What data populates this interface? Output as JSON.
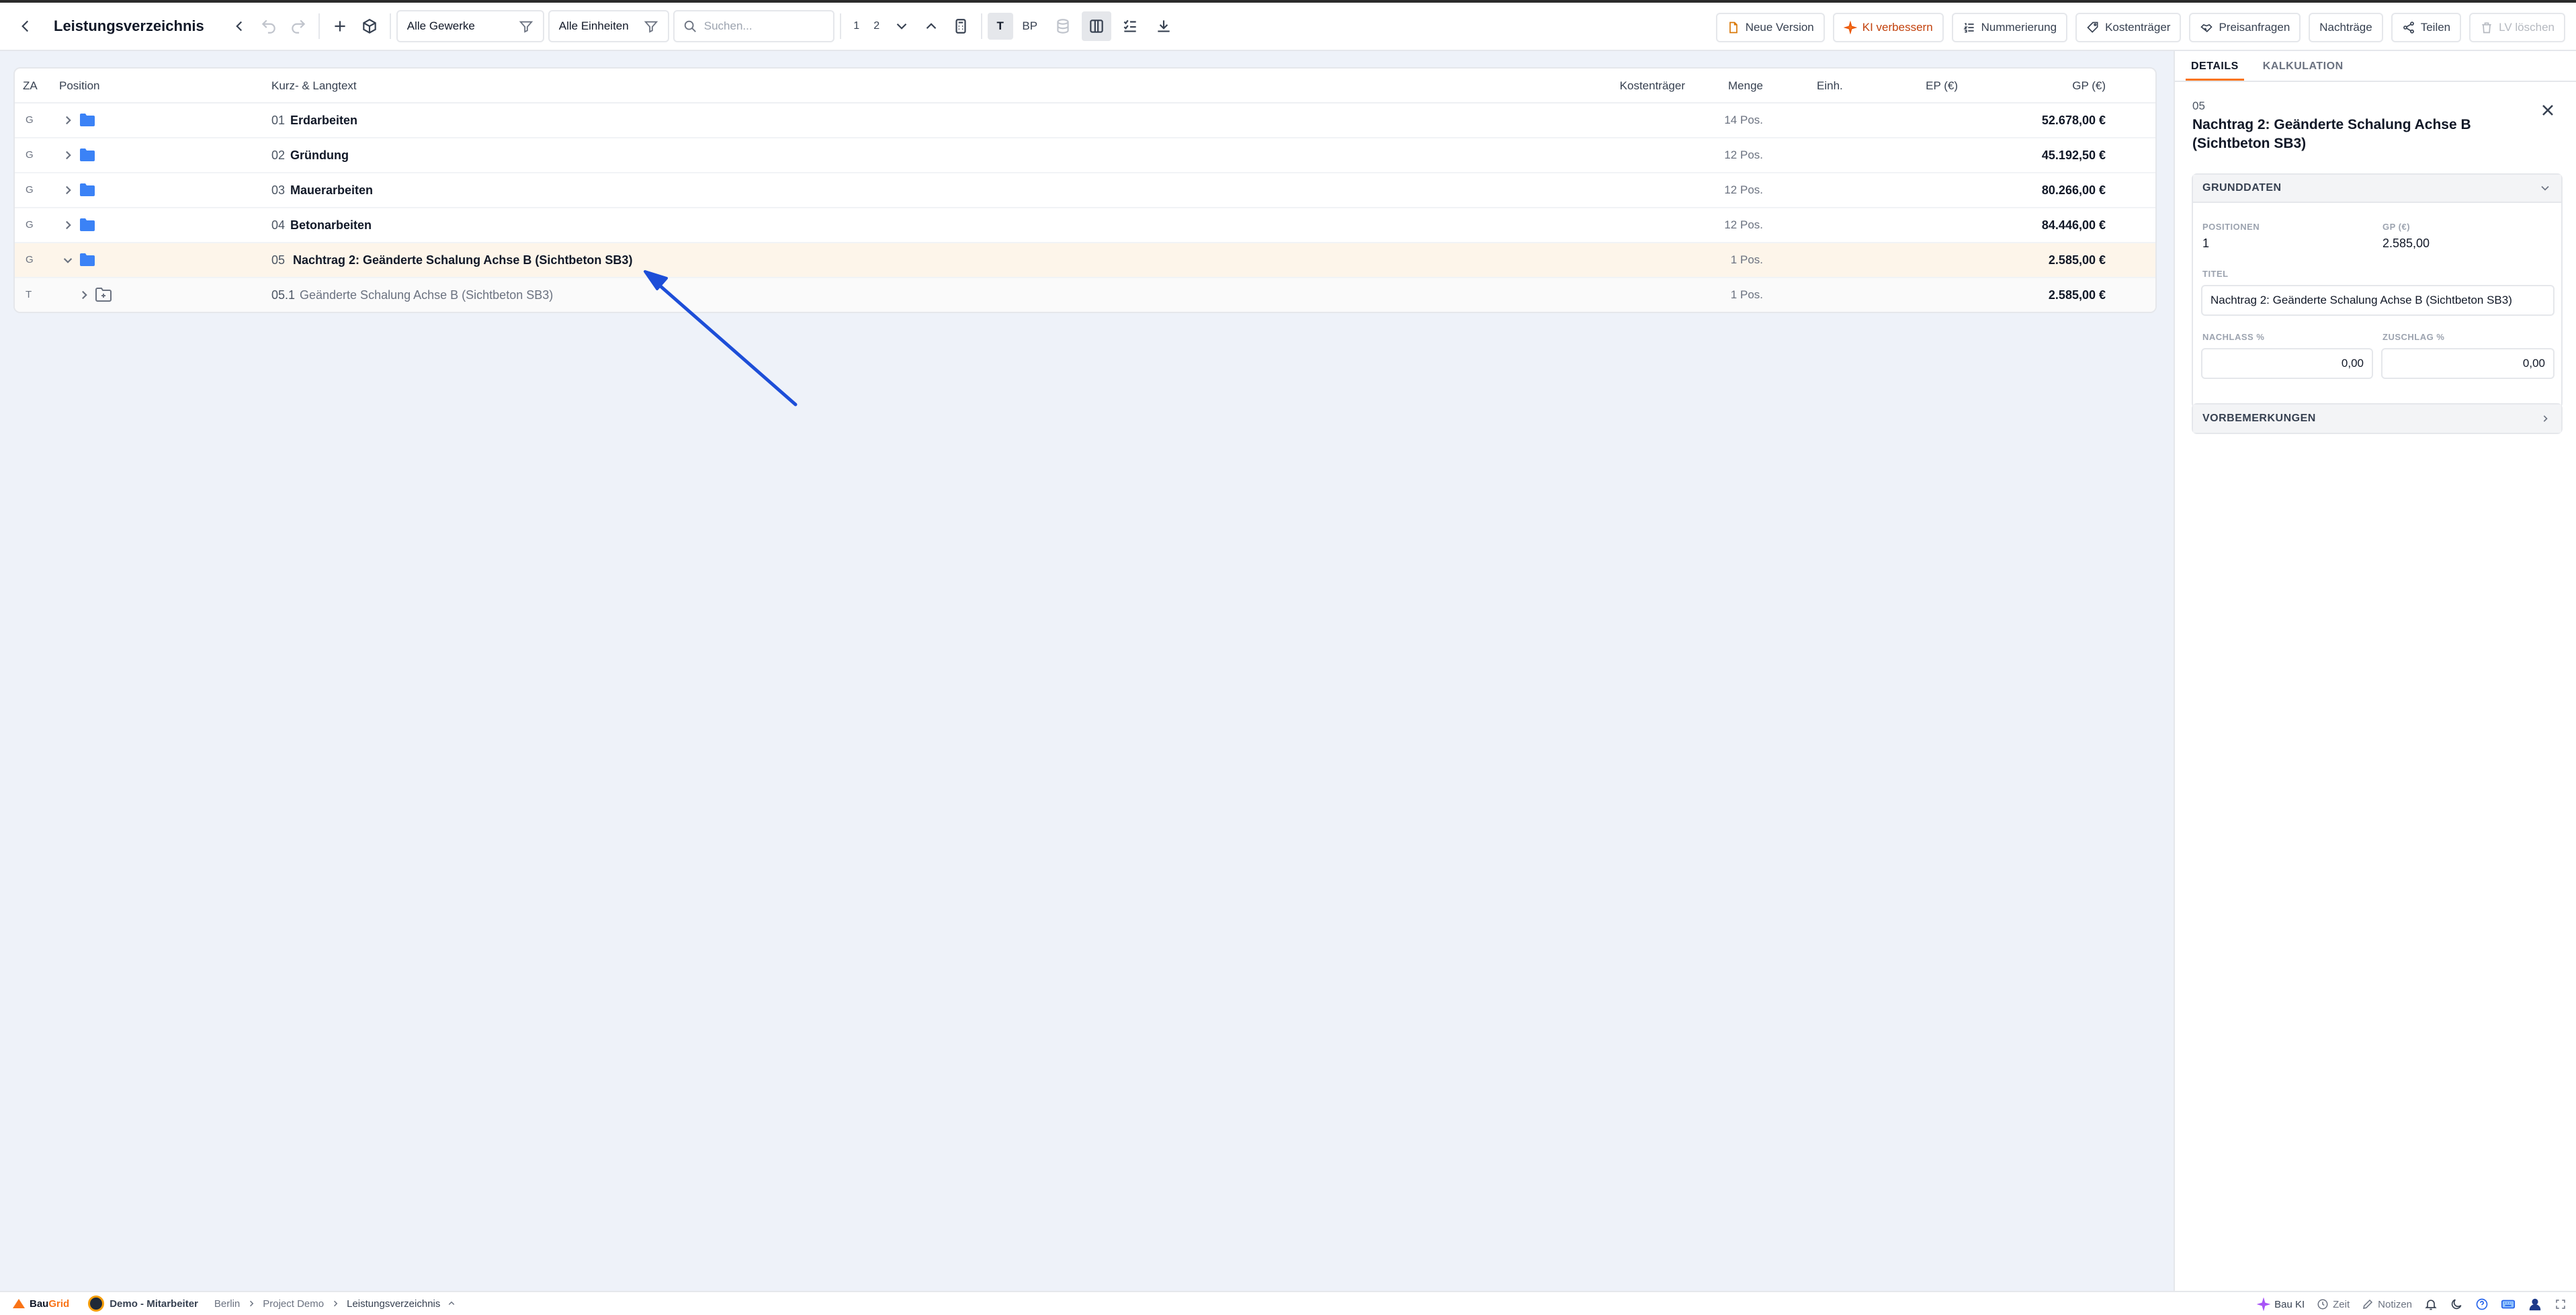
{
  "header": {
    "title": "Leistungsverzeichnis",
    "filter_gewerke": "Alle Gewerke",
    "filter_einheiten": "Alle Einheiten",
    "search_placeholder": "Suchen...",
    "level_1": "1",
    "level_2": "2",
    "view_t": "T",
    "view_bp": "BP",
    "actions": {
      "neue_version": "Neue Version",
      "ki_verbessern": "KI verbessern",
      "nummerierung": "Nummerierung",
      "kostentraeger": "Kostenträger",
      "preisanfragen": "Preisanfragen",
      "nachtraege": "Nachträge",
      "teilen": "Teilen",
      "lv_loeschen": "LV löschen"
    }
  },
  "table": {
    "columns": {
      "za": "ZA",
      "position": "Position",
      "text": "Kurz- & Langtext",
      "kostentraeger": "Kostenträger",
      "menge": "Menge",
      "einh": "Einh.",
      "ep": "EP (€)",
      "gp": "GP (€)"
    },
    "rows": [
      {
        "za": "G",
        "num": "01",
        "name": "Erdarbeiten",
        "qty": "14 Pos.",
        "gp": "52.678,00 €"
      },
      {
        "za": "G",
        "num": "02",
        "name": "Gründung",
        "qty": "12 Pos.",
        "gp": "45.192,50 €"
      },
      {
        "za": "G",
        "num": "03",
        "name": "Mauerarbeiten",
        "qty": "12 Pos.",
        "gp": "80.266,00 €"
      },
      {
        "za": "G",
        "num": "04",
        "name": "Betonarbeiten",
        "qty": "12 Pos.",
        "gp": "84.446,00 €"
      },
      {
        "za": "G",
        "num": "05",
        "name": "Nachtrag 2: Geänderte Schalung Achse B (Sichtbeton SB3)",
        "qty": "1 Pos.",
        "gp": "2.585,00 €"
      },
      {
        "za": "T",
        "num": "05.1",
        "name": "Geänderte Schalung Achse B (Sichtbeton SB3)",
        "qty": "1 Pos.",
        "gp": "2.585,00 €"
      }
    ]
  },
  "details": {
    "tab_details": "DETAILS",
    "tab_kalkulation": "KALKULATION",
    "number": "05",
    "title": "Nachtrag 2: Geänderte Schalung Achse B (Sichtbeton SB3)",
    "grunddaten": {
      "heading": "GRUNDDATEN",
      "positionen_label": "POSITIONEN",
      "positionen_value": "1",
      "gp_label": "GP (€)",
      "gp_value": "2.585,00",
      "titel_label": "TITEL",
      "titel_value": "Nachtrag 2: Geänderte Schalung Achse B (Sichtbeton SB3)",
      "nachlass_label": "NACHLASS %",
      "nachlass_value": "0,00",
      "zuschlag_label": "ZUSCHLAG %",
      "zuschlag_value": "0,00"
    },
    "vorbemerkungen": "VORBEMERKUNGEN"
  },
  "footer": {
    "brand_bau": "Bau",
    "brand_grid": "Grid",
    "user": "Demo - Mitarbeiter",
    "crumbs": [
      "Berlin",
      "Project Demo",
      "Leistungsverzeichnis"
    ],
    "bau_ki": "Bau KI",
    "zeit": "Zeit",
    "notizen": "Notizen"
  },
  "colors": {
    "accent": "#f97316",
    "folder": "#3b82f6",
    "selected_row": "#fdf5ea",
    "annotation_arrow": "#1d4ed8"
  }
}
